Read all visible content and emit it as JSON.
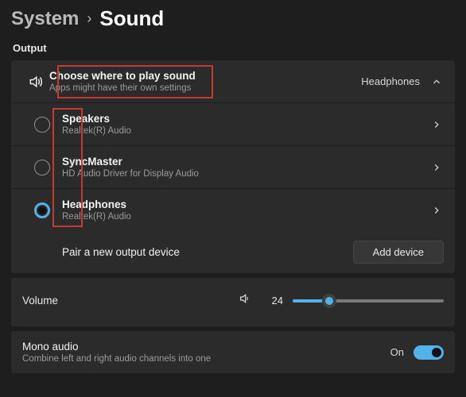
{
  "breadcrumb": {
    "parent": "System",
    "sep": "›",
    "title": "Sound"
  },
  "section": {
    "output": "Output"
  },
  "output_header": {
    "title": "Choose where to play sound",
    "subtitle": "Apps might have their own settings",
    "current": "Headphones"
  },
  "devices": [
    {
      "name": "Speakers",
      "driver": "Realtek(R) Audio",
      "selected": false
    },
    {
      "name": "SyncMaster",
      "driver": "HD Audio Driver for Display Audio",
      "selected": false
    },
    {
      "name": "Headphones",
      "driver": "Realtek(R) Audio",
      "selected": true
    }
  ],
  "pair": {
    "label": "Pair a new output device",
    "button": "Add device"
  },
  "volume": {
    "label": "Volume",
    "value": 24,
    "min": 0,
    "max": 100
  },
  "mono": {
    "label": "Mono audio",
    "desc": "Combine left and right audio channels into one",
    "state_text": "On",
    "on": true
  },
  "colors": {
    "accent": "#50b2e8",
    "highlight": "#c63a31"
  }
}
